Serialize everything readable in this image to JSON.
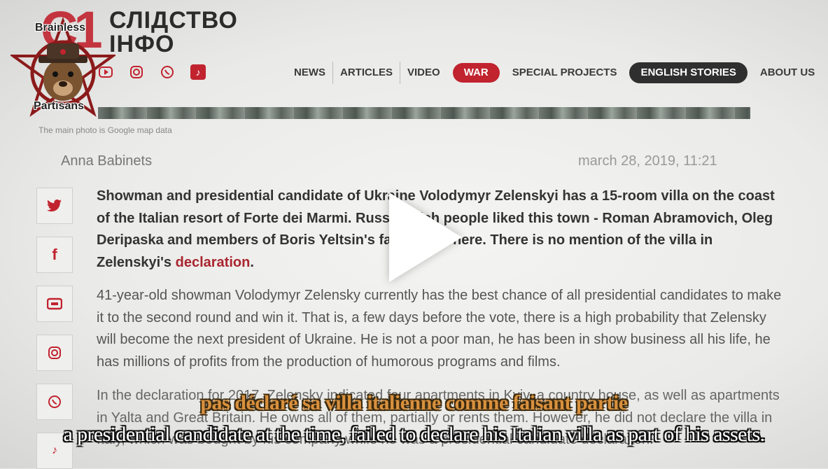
{
  "site": {
    "logo_mark": "C1",
    "logo_line1": "СЛІДСТВО",
    "logo_line2": "ІНФО"
  },
  "watermark": {
    "top_text": "Brainless",
    "bottom_text": "Partisans"
  },
  "social_top": [
    "youtube-icon",
    "instagram-icon",
    "viber-icon",
    "tiktok-icon"
  ],
  "nav": {
    "items": [
      {
        "label": "NEWS"
      },
      {
        "label": "ARTICLES"
      },
      {
        "label": "VIDEO"
      },
      {
        "label": "WAR"
      },
      {
        "label": "SPECIAL PROJECTS"
      },
      {
        "label": "ENGLISH STORIES"
      },
      {
        "label": "ABOUT US"
      }
    ]
  },
  "article": {
    "photo_caption": "The main photo is Google map data",
    "author": "Anna Babinets",
    "date": "march 28, 2019, 11:21",
    "lead_text": "Showman and presidential candidate of Ukraine Volodymyr Zelenskyi has a 15-room villa on the coast of the Italian resort of Forte dei Marmi. Russian rich people liked this town - Roman Abramovich, Oleg Deripaska and members of Boris Yeltsin's family rest here. There is no mention of the villa in Zelenskyi's ",
    "lead_link": "declaration",
    "lead_end": ".",
    "paragraph1": "41-year-old showman Volodymyr Zelensky currently has the best chance of all presidential candidates to make it to the second round and win it. That is, a few days before the vote, there is a high probability that Zelensky will become the next president of Ukraine. He is not a poor man, he has been in show business all his life, he has millions of profits from the production of humorous programs and films.",
    "paragraph2": "In the declaration for 2017, Zelensky indicated four apartments in Kyiv, a country house, as well as apartments in Yalta and Great Britain. He owns all of them, partially or rents them. However, he did not declare the villa in Italy, which was bought by his company while he was a presidential candidate declaration."
  },
  "share_buttons": [
    "twitter-icon",
    "facebook-icon",
    "youtube-icon",
    "instagram-icon",
    "viber-icon",
    "tiktok-icon"
  ],
  "video": {
    "play_icon": "play-icon",
    "subtitle_fr": "pas déclaré sa villa italienne comme faisant partie",
    "subtitle_en": "a presidential candidate at the time, failed to declare his Italian villa as part of his assets."
  },
  "colors": {
    "brand_red": "#c1232f",
    "dark_pill": "#2f2f2f",
    "subtitle_fr": "#d9903d"
  }
}
